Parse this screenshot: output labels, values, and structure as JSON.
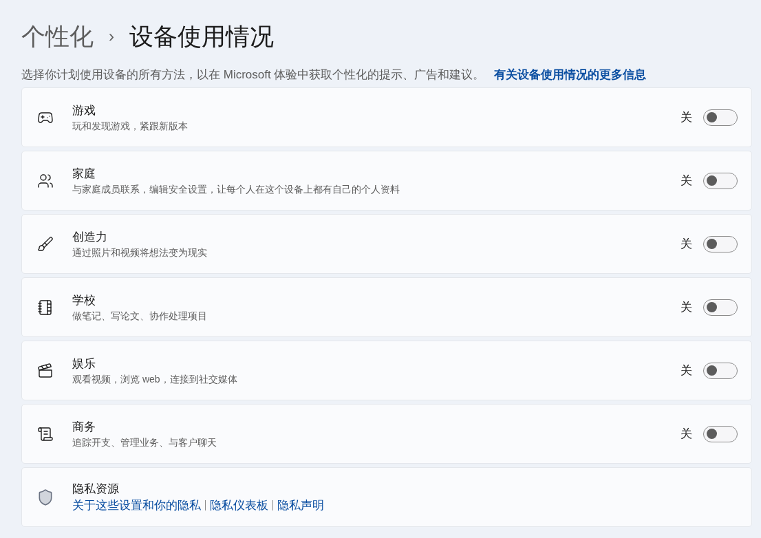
{
  "breadcrumb": {
    "parent": "个性化",
    "separator": "›",
    "current": "设备使用情况"
  },
  "intro": {
    "text": "选择你计划使用设备的所有方法，以在 Microsoft 体验中获取个性化的提示、广告和建议。",
    "link": "有关设备使用情况的更多信息"
  },
  "settings": [
    {
      "kind": "toggle",
      "title": "游戏",
      "description": "玩和发现游戏，紧跟新版本",
      "state_label": "关",
      "on": false
    },
    {
      "kind": "toggle",
      "title": "家庭",
      "description": "与家庭成员联系，编辑安全设置，让每个人在这个设备上都有自己的个人资料",
      "state_label": "关",
      "on": false
    },
    {
      "kind": "toggle",
      "title": "创造力",
      "description": "通过照片和视频将想法变为现实",
      "state_label": "关",
      "on": false
    },
    {
      "kind": "toggle",
      "title": "学校",
      "description": "做笔记、写论文、协作处理项目",
      "state_label": "关",
      "on": false
    },
    {
      "kind": "toggle",
      "title": "娱乐",
      "description": "观看视频，浏览 web，连接到社交媒体",
      "state_label": "关",
      "on": false
    },
    {
      "kind": "toggle",
      "title": "商务",
      "description": "追踪开支、管理业务、与客户聊天",
      "state_label": "关",
      "on": false
    },
    {
      "kind": "links",
      "title": "隐私资源",
      "links": [
        "关于这些设置和你的隐私",
        "隐私仪表板",
        "隐私声明"
      ]
    }
  ]
}
